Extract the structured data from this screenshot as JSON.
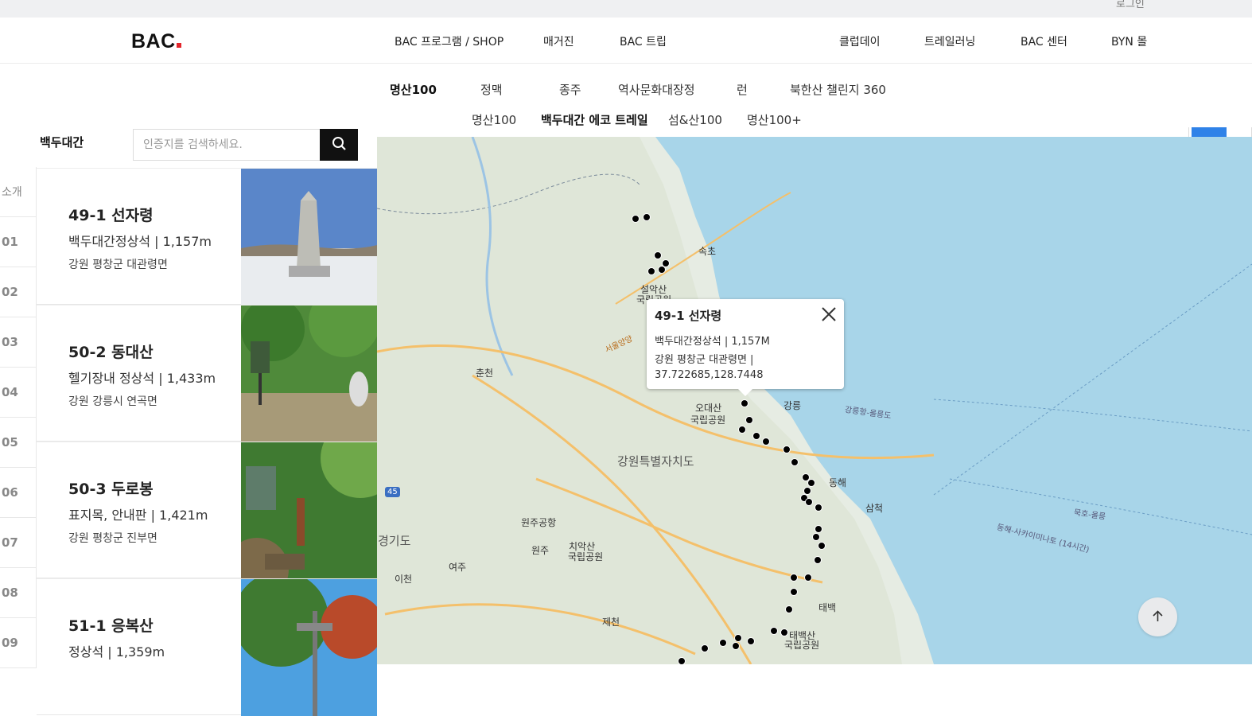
{
  "top": {
    "login_label": "로그인"
  },
  "header": {
    "logo": "BAC",
    "nav": [
      "BAC 프로그램 / SHOP",
      "매거진",
      "BAC 트립",
      "클럽데이",
      "트레일러닝",
      "BAC 센터",
      "BYN 몰"
    ]
  },
  "subnav": {
    "row1": [
      "명산100",
      "정맥",
      "종주",
      "역사문화대장정",
      "런",
      "북한산 챌린지 360"
    ],
    "row2": [
      "명산100",
      "백두대간 에코 트레일",
      "섬&산100",
      "명산100+"
    ]
  },
  "left": {
    "title": "백두대간",
    "search_placeholder": "인증지를 검색하세요.",
    "index": [
      "소개",
      "01",
      "02",
      "03",
      "04",
      "05",
      "06",
      "07",
      "08",
      "09"
    ],
    "cards": [
      {
        "title": "49-1 선자령",
        "sub": "백두대간정상석 | 1,157m",
        "loc": "강원 평창군 대관령면"
      },
      {
        "title": "50-2 동대산",
        "sub": "헬기장내 정상석 | 1,433m",
        "loc": "강원 강릉시 연곡면"
      },
      {
        "title": "50-3 두로봉",
        "sub": "표지목, 안내판 | 1,421m",
        "loc": "강원 평창군 진부면"
      },
      {
        "title": "51-1 응복산",
        "sub": "정상석 | 1,359m",
        "loc": ""
      }
    ]
  },
  "map": {
    "labels": {
      "sokcho": "속초",
      "seorak1": "설악산",
      "seorak2": "국립공원",
      "chuncheon": "춘천",
      "odae1": "오대산",
      "odae2": "국립공원",
      "gangneung": "강릉",
      "gangwon": "강원특별자치도",
      "donghae": "동해",
      "samcheok": "삼척",
      "wonju_airport": "원주공항",
      "wonju": "원주",
      "chiak1": "치악산",
      "chiak2": "국립공원",
      "gyeonggi": "경기도",
      "yeoju": "여주",
      "icheon": "이천",
      "jecheon": "제천",
      "taebaek": "태백",
      "taebaeksan1": "태백산",
      "taebaeksan2": "국립공원",
      "route_gn": "강릉항-울릉도",
      "route_mh": "묵호-울릉",
      "route_sk": "동해-사카이미나토 (14시간)",
      "expressway": "45",
      "seoul_yy": "서울양양"
    },
    "popup": {
      "title": "49-1 선자령",
      "line1": "백두대간정상석 | 1,157M",
      "line2": "강원 평창군 대관령면 |",
      "line3": "37.722685,128.7448"
    }
  },
  "colors": {
    "accent_red": "#e3262c",
    "sea": "#a8d5e9",
    "road": "#f4c06b"
  }
}
